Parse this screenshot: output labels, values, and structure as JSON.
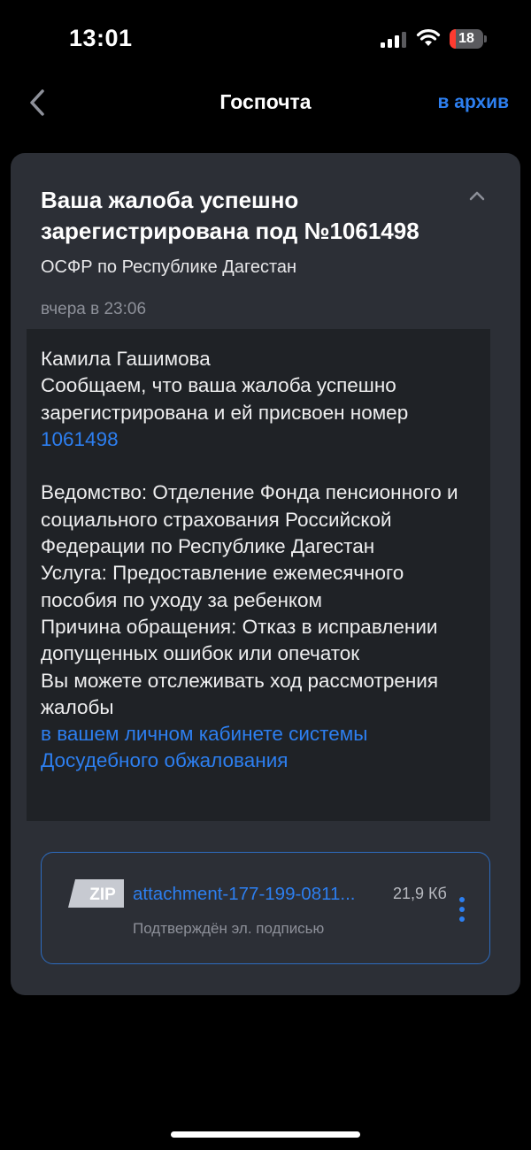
{
  "status_bar": {
    "time": "13:01",
    "battery_level": "18",
    "battery_fraction": 0.18,
    "battery_color": "#ff3b30",
    "icons": [
      "signal-icon",
      "wifi-icon",
      "battery-icon"
    ]
  },
  "nav": {
    "title": "Госпочта",
    "archive_label": "в архив",
    "back_icon": "chevron-left-icon"
  },
  "message": {
    "subject": "Ваша жалоба успешно зарегистрирована под №1061498",
    "sender": "ОСФР по Республике Дагестан",
    "timestamp": "вчера в 23:06",
    "collapse_icon": "chevron-up-icon",
    "body": {
      "greeting": "Камила Гашимова",
      "intro": "Сообщаем, что ваша жалоба успешно зарегистрирована и ей присвоен номер",
      "number_link": "1061498",
      "department": "Ведомство: Отделение Фонда пенсионного и социального страхования Российской Федерации по Республике Дагестан",
      "service": "Услуга: Предоставление ежемесячного пособия по уходу за ребенком",
      "reason": "Причина обращения: Отказ в исправлении допущенных ошибок или опечаток",
      "tracking_text": "Вы можете отслеживать ход рассмотрения жалобы",
      "tracking_link": "в вашем личном кабинете системы Досудебного обжалования"
    },
    "attachment": {
      "type_label": "ZIP",
      "file_name": "attachment-177-199-0811...",
      "size": "21,9 Кб",
      "signature": "Подтверждён эл. подписью",
      "menu_icon": "more-vertical-icon"
    }
  },
  "colors": {
    "accent": "#2d7ff0",
    "background": "#000000",
    "card": "#2c2f36",
    "body_panel": "#1f2226"
  }
}
